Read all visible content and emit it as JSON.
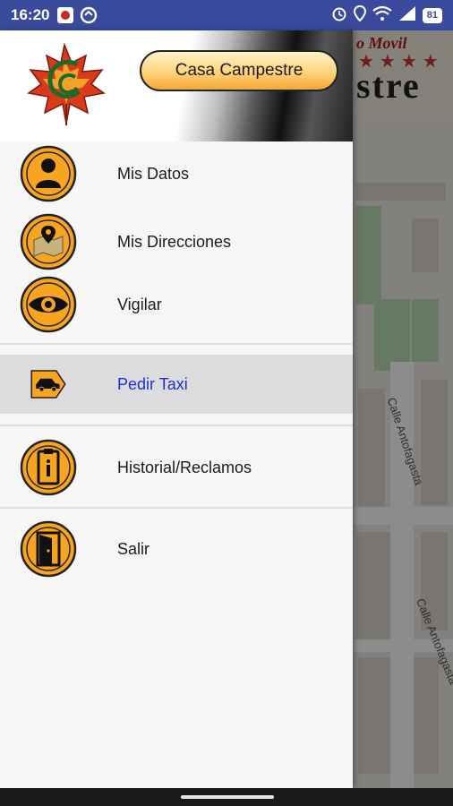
{
  "status_bar": {
    "time": "16:20",
    "icons_left": [
      "app-notification-icon",
      "sync-icon"
    ],
    "icons_right": [
      "alarm-icon",
      "location-icon",
      "wifi-icon",
      "signal-icon"
    ],
    "battery": "81"
  },
  "background_app": {
    "brand_top": "o Movil",
    "brand_bottom": "stre",
    "streets": [
      "Calle Antofagasta",
      "Calle Antofagasta"
    ]
  },
  "drawer": {
    "profile_button": "Casa Campestre",
    "menu": [
      {
        "label": "Mis Datos",
        "icon": "person-icon"
      },
      {
        "label": "Mis Direcciones",
        "icon": "map-pin-icon"
      },
      {
        "label": "Vigilar",
        "icon": "eye-icon"
      },
      {
        "label": "Pedir Taxi",
        "icon": "taxi-icon",
        "active": true
      },
      {
        "label": "Historial/Reclamos",
        "icon": "clipboard-icon"
      },
      {
        "label": "Salir",
        "icon": "exit-door-icon"
      }
    ]
  },
  "colors": {
    "status_bar": "#3a4a9c",
    "accent_orange": "#f4a737",
    "active_label": "#1c2fd6",
    "active_bg": "#dcdcdc"
  }
}
